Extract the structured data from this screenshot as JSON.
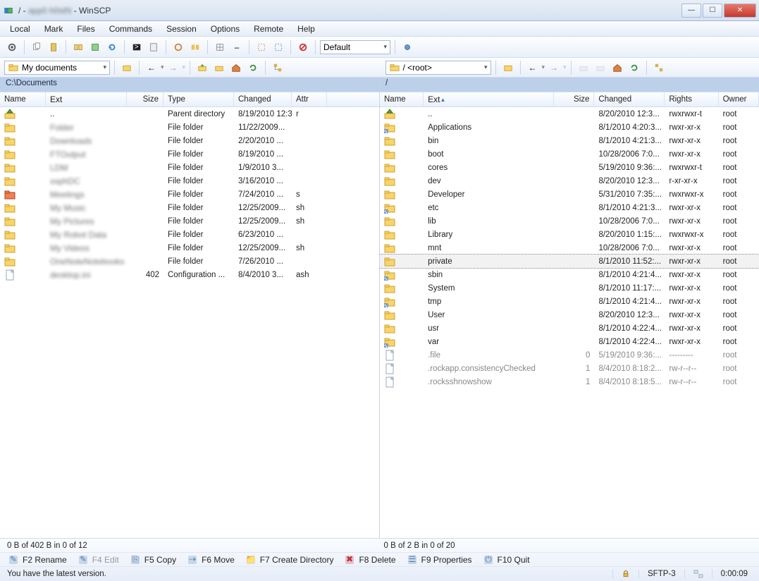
{
  "title": "/ - ",
  "title_blurred": "app0 h0stN",
  "title_suffix": " - WinSCP",
  "menubar": [
    "Local",
    "Mark",
    "Files",
    "Commands",
    "Session",
    "Options",
    "Remote",
    "Help"
  ],
  "toolbar_select": "Default",
  "local": {
    "nav_label": "My documents",
    "path": "C:\\Documents",
    "columns": [
      "Name",
      "Ext",
      "Size",
      "Type",
      "Changed",
      "Attr"
    ],
    "rows": [
      {
        "icon": "up",
        "name": "..",
        "type": "Parent directory",
        "changed": "8/19/2010  12:3...",
        "attr": "r"
      },
      {
        "icon": "folder",
        "name": "Folder",
        "blur": true,
        "type": "File folder",
        "changed": "11/22/2009..."
      },
      {
        "icon": "folder",
        "name": "Downloads",
        "blur": true,
        "type": "File folder",
        "changed": "2/20/2010  ..."
      },
      {
        "icon": "folder",
        "name": "FTOutput",
        "blur": true,
        "type": "File folder",
        "changed": "8/19/2010  ..."
      },
      {
        "icon": "folder",
        "name": "LDM",
        "blur": true,
        "type": "File folder",
        "changed": "1/9/2010  3..."
      },
      {
        "icon": "folder",
        "name": "xxphDC",
        "blur": true,
        "type": "File folder",
        "changed": "3/16/2010  ..."
      },
      {
        "icon": "folder-red",
        "name": "Meetings",
        "blur": true,
        "type": "File folder",
        "changed": "7/24/2010  ...",
        "attr": "s"
      },
      {
        "icon": "folder",
        "name": "My Music",
        "blur": true,
        "type": "File folder",
        "changed": "12/25/2009...",
        "attr": "sh"
      },
      {
        "icon": "folder",
        "name": "My Pictures",
        "blur": true,
        "type": "File folder",
        "changed": "12/25/2009...",
        "attr": "sh"
      },
      {
        "icon": "folder",
        "name": "My Robot Data",
        "blur": true,
        "type": "File folder",
        "changed": "6/23/2010  ..."
      },
      {
        "icon": "folder",
        "name": "My Videos",
        "blur": true,
        "type": "File folder",
        "changed": "12/25/2009...",
        "attr": "sh"
      },
      {
        "icon": "folder",
        "name": "OneNoteNotebooks",
        "blur": true,
        "type": "File folder",
        "changed": "7/26/2010  ..."
      },
      {
        "icon": "file",
        "name": "desktop.ini",
        "blur": true,
        "size": "402",
        "type": "Configuration ...",
        "changed": "8/4/2010  3...",
        "attr": "ash"
      }
    ],
    "status": "0 B of 402 B in 0 of 12"
  },
  "remote": {
    "nav_label": "/ <root>",
    "path": "/",
    "columns": [
      "Name",
      "Ext",
      "Size",
      "Changed",
      "Rights",
      "Owner"
    ],
    "rows": [
      {
        "icon": "up",
        "name": "..",
        "changed": "8/20/2010 12:3...",
        "rights": "rwxrwxr-t",
        "owner": "root"
      },
      {
        "icon": "folder-sc",
        "name": "Applications",
        "changed": "8/1/2010 4:20:3...",
        "rights": "rwxr-xr-x",
        "owner": "root"
      },
      {
        "icon": "folder",
        "name": "bin",
        "changed": "8/1/2010 4:21:3...",
        "rights": "rwxr-xr-x",
        "owner": "root"
      },
      {
        "icon": "folder",
        "name": "boot",
        "changed": "10/28/2006 7:0...",
        "rights": "rwxr-xr-x",
        "owner": "root"
      },
      {
        "icon": "folder",
        "name": "cores",
        "changed": "5/19/2010 9:36:...",
        "rights": "rwxrwxr-t",
        "owner": "root"
      },
      {
        "icon": "folder",
        "name": "dev",
        "changed": "8/20/2010 12:3...",
        "rights": "r-xr-xr-x",
        "owner": "root"
      },
      {
        "icon": "folder",
        "name": "Developer",
        "changed": "5/31/2010 7:35:...",
        "rights": "rwxrwxr-x",
        "owner": "root"
      },
      {
        "icon": "folder-sc",
        "name": "etc",
        "changed": "8/1/2010 4:21:3...",
        "rights": "rwxr-xr-x",
        "owner": "root"
      },
      {
        "icon": "folder",
        "name": "lib",
        "changed": "10/28/2006 7:0...",
        "rights": "rwxr-xr-x",
        "owner": "root"
      },
      {
        "icon": "folder",
        "name": "Library",
        "changed": "8/20/2010 1:15:...",
        "rights": "rwxrwxr-x",
        "owner": "root"
      },
      {
        "icon": "folder",
        "name": "mnt",
        "changed": "10/28/2006 7:0...",
        "rights": "rwxr-xr-x",
        "owner": "root"
      },
      {
        "icon": "folder",
        "name": "private",
        "sel": true,
        "changed": "8/1/2010 11:52:...",
        "rights": "rwxr-xr-x",
        "owner": "root"
      },
      {
        "icon": "folder-sc",
        "name": "sbin",
        "changed": "8/1/2010 4:21:4...",
        "rights": "rwxr-xr-x",
        "owner": "root"
      },
      {
        "icon": "folder",
        "name": "System",
        "changed": "8/1/2010 11:17:...",
        "rights": "rwxr-xr-x",
        "owner": "root"
      },
      {
        "icon": "folder-sc",
        "name": "tmp",
        "changed": "8/1/2010 4:21:4...",
        "rights": "rwxr-xr-x",
        "owner": "root"
      },
      {
        "icon": "folder",
        "name": "User",
        "changed": "8/20/2010 12:3...",
        "rights": "rwxr-xr-x",
        "owner": "root"
      },
      {
        "icon": "folder",
        "name": "usr",
        "changed": "8/1/2010 4:22:4...",
        "rights": "rwxr-xr-x",
        "owner": "root"
      },
      {
        "icon": "folder-sc",
        "name": "var",
        "changed": "8/1/2010 4:22:4...",
        "rights": "rwxr-xr-x",
        "owner": "root"
      },
      {
        "icon": "file",
        "name": ".file",
        "dim": true,
        "size": "0",
        "changed": "5/19/2010 9:36:...",
        "rights": "---------",
        "owner": "root"
      },
      {
        "icon": "file",
        "name": ".rockapp.consistencyChecked",
        "dim": true,
        "size": "1",
        "changed": "8/4/2010 8:18:2...",
        "rights": "rw-r--r--",
        "owner": "root"
      },
      {
        "icon": "file",
        "name": ".rocksshnowshow",
        "dim": true,
        "size": "1",
        "changed": "8/4/2010 8:18:5...",
        "rights": "rw-r--r--",
        "owner": "root"
      }
    ],
    "status": "0 B of 2 B in 0 of 20"
  },
  "fnkeys": [
    {
      "label": "F2 Rename",
      "icon": "rename"
    },
    {
      "label": "F4 Edit",
      "icon": "edit",
      "dim": true
    },
    {
      "label": "F5 Copy",
      "icon": "copy"
    },
    {
      "label": "F6 Move",
      "icon": "move"
    },
    {
      "label": "F7 Create Directory",
      "icon": "mkdir"
    },
    {
      "label": "F8 Delete",
      "icon": "delete"
    },
    {
      "label": "F9 Properties",
      "icon": "props"
    },
    {
      "label": "F10 Quit",
      "icon": "quit"
    }
  ],
  "statusbar": {
    "msg": "You have the latest version.",
    "protocol": "SFTP-3",
    "time": "0:00:09"
  }
}
